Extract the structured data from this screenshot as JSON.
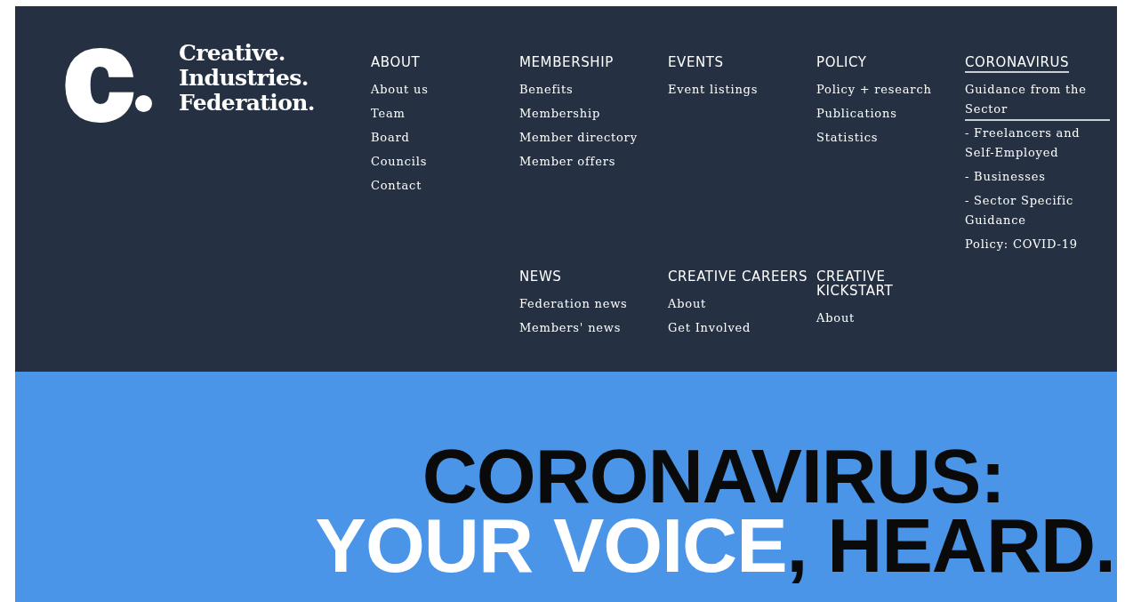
{
  "logo": {
    "mark": "c",
    "lines": [
      "Creative.",
      "Industries.",
      "Federation."
    ]
  },
  "menu": {
    "rows": [
      [
        {
          "heading": "ABOUT",
          "selected": false,
          "items": [
            {
              "label": "About us",
              "selected": false
            },
            {
              "label": "Team",
              "selected": false
            },
            {
              "label": "Board",
              "selected": false
            },
            {
              "label": "Councils",
              "selected": false
            },
            {
              "label": "Contact",
              "selected": false
            }
          ]
        },
        {
          "heading": "MEMBERSHIP",
          "selected": false,
          "items": [
            {
              "label": "Benefits",
              "selected": false
            },
            {
              "label": "Membership",
              "selected": false
            },
            {
              "label": "Member directory",
              "selected": false
            },
            {
              "label": "Member offers",
              "selected": false
            }
          ]
        },
        {
          "heading": "EVENTS",
          "selected": false,
          "items": [
            {
              "label": "Event listings",
              "selected": false
            }
          ]
        },
        {
          "heading": "POLICY",
          "selected": false,
          "items": [
            {
              "label": "Policy + research",
              "selected": false
            },
            {
              "label": "Publications",
              "selected": false
            },
            {
              "label": "Statistics",
              "selected": false
            }
          ]
        },
        {
          "heading": "CORONAVIRUS",
          "selected": true,
          "items": [
            {
              "label": "Guidance from the Sector",
              "selected": true
            },
            {
              "label": "- Freelancers and Self-Employed",
              "selected": false
            },
            {
              "label": "- Businesses",
              "selected": false
            },
            {
              "label": "- Sector Specific Guidance",
              "selected": false
            },
            {
              "label": "Policy: COVID-19",
              "selected": false
            }
          ]
        }
      ],
      [
        "",
        {
          "heading": "NEWS",
          "selected": false,
          "items": [
            {
              "label": "Federation news",
              "selected": false
            },
            {
              "label": "Members' news",
              "selected": false
            }
          ]
        },
        {
          "heading": "CREATIVE CAREERS",
          "selected": false,
          "items": [
            {
              "label": "About",
              "selected": false
            },
            {
              "label": "Get Involved",
              "selected": false
            }
          ]
        },
        {
          "heading": "CREATIVE KICKSTART",
          "selected": false,
          "items": [
            {
              "label": "About",
              "selected": false
            }
          ]
        }
      ]
    ]
  },
  "hero": {
    "lines": [
      {
        "parts": [
          {
            "text": "CORONAVIRUS:",
            "color": "#0a0a0a"
          }
        ]
      },
      {
        "parts": [
          {
            "text": "YOUR VOICE",
            "color": "#ffffff"
          },
          {
            "text": ", HEARD.",
            "color": "#0a0a0a"
          }
        ]
      }
    ]
  }
}
